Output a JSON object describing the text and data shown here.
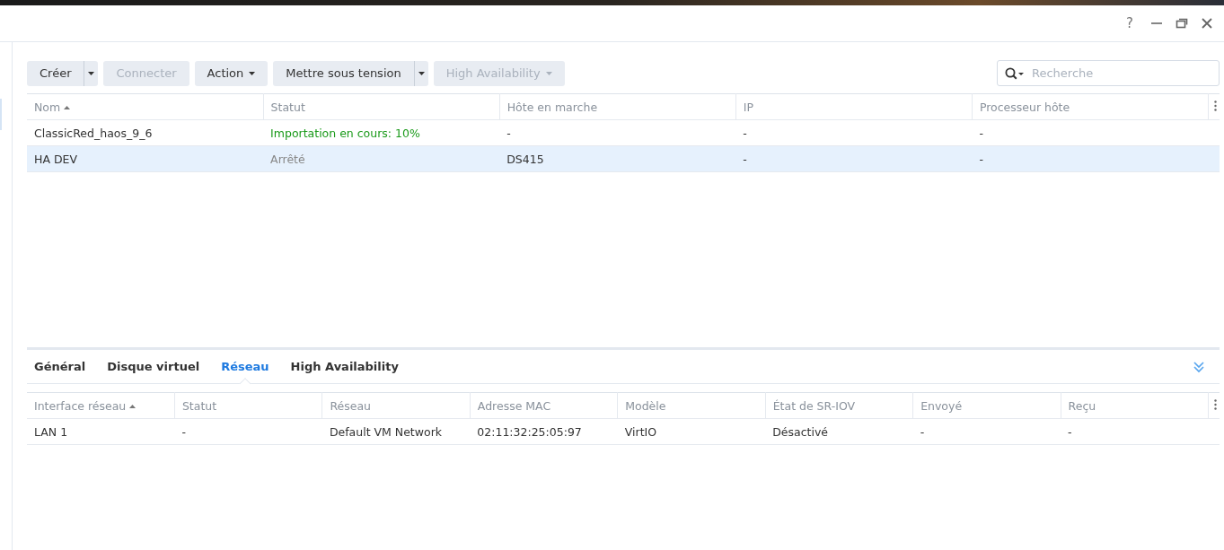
{
  "window": {
    "controls": [
      "?"
    ]
  },
  "toolbar": {
    "buttons": [
      {
        "label": "Créer",
        "kind": "split",
        "disabled": false
      },
      {
        "label": "Connecter",
        "kind": "plain",
        "disabled": true
      },
      {
        "label": "Action",
        "kind": "menu",
        "disabled": false
      },
      {
        "label": "Mettre sous tension",
        "kind": "split",
        "disabled": false
      },
      {
        "label": "High Availability",
        "kind": "menu",
        "disabled": true
      }
    ],
    "search": {
      "placeholder": "Recherche"
    }
  },
  "vm_table": {
    "columns": [
      {
        "label": "Nom",
        "sorted": true
      },
      {
        "label": "Statut",
        "sorted": false
      },
      {
        "label": "Hôte en marche",
        "sorted": false
      },
      {
        "label": "IP",
        "sorted": false
      },
      {
        "label": "Processeur hôte",
        "sorted": false
      }
    ],
    "rows": [
      {
        "selected": false,
        "kind": "running_task",
        "cells": [
          "ClassicRed_haos_9_6",
          "Importation en cours: 10%",
          "-",
          "-",
          "-"
        ]
      },
      {
        "selected": true,
        "kind": "stopped",
        "cells": [
          "HA DEV",
          "Arrêté",
          "DS415",
          "-",
          "-"
        ]
      }
    ]
  },
  "detail_tabs": [
    {
      "label": "Général",
      "selected": false
    },
    {
      "label": "Disque virtuel",
      "selected": false
    },
    {
      "label": "Réseau",
      "selected": true
    },
    {
      "label": "High Availability",
      "selected": false
    }
  ],
  "network_table": {
    "columns": [
      {
        "label": "Interface réseau",
        "sorted": true
      },
      {
        "label": "Statut",
        "sorted": false
      },
      {
        "label": "Réseau",
        "sorted": false
      },
      {
        "label": "Adresse MAC",
        "sorted": false
      },
      {
        "label": "Modèle",
        "sorted": false
      },
      {
        "label": "État de SR-IOV",
        "sorted": false
      },
      {
        "label": "Envoyé",
        "sorted": false
      },
      {
        "label": "Reçu",
        "sorted": false
      }
    ],
    "rows": [
      {
        "selected": false,
        "cells": [
          "LAN 1",
          "-",
          "Default VM Network",
          "02:11:32:25:05:97",
          "VirtIO",
          "Désactivé",
          "-",
          "-"
        ]
      }
    ]
  }
}
